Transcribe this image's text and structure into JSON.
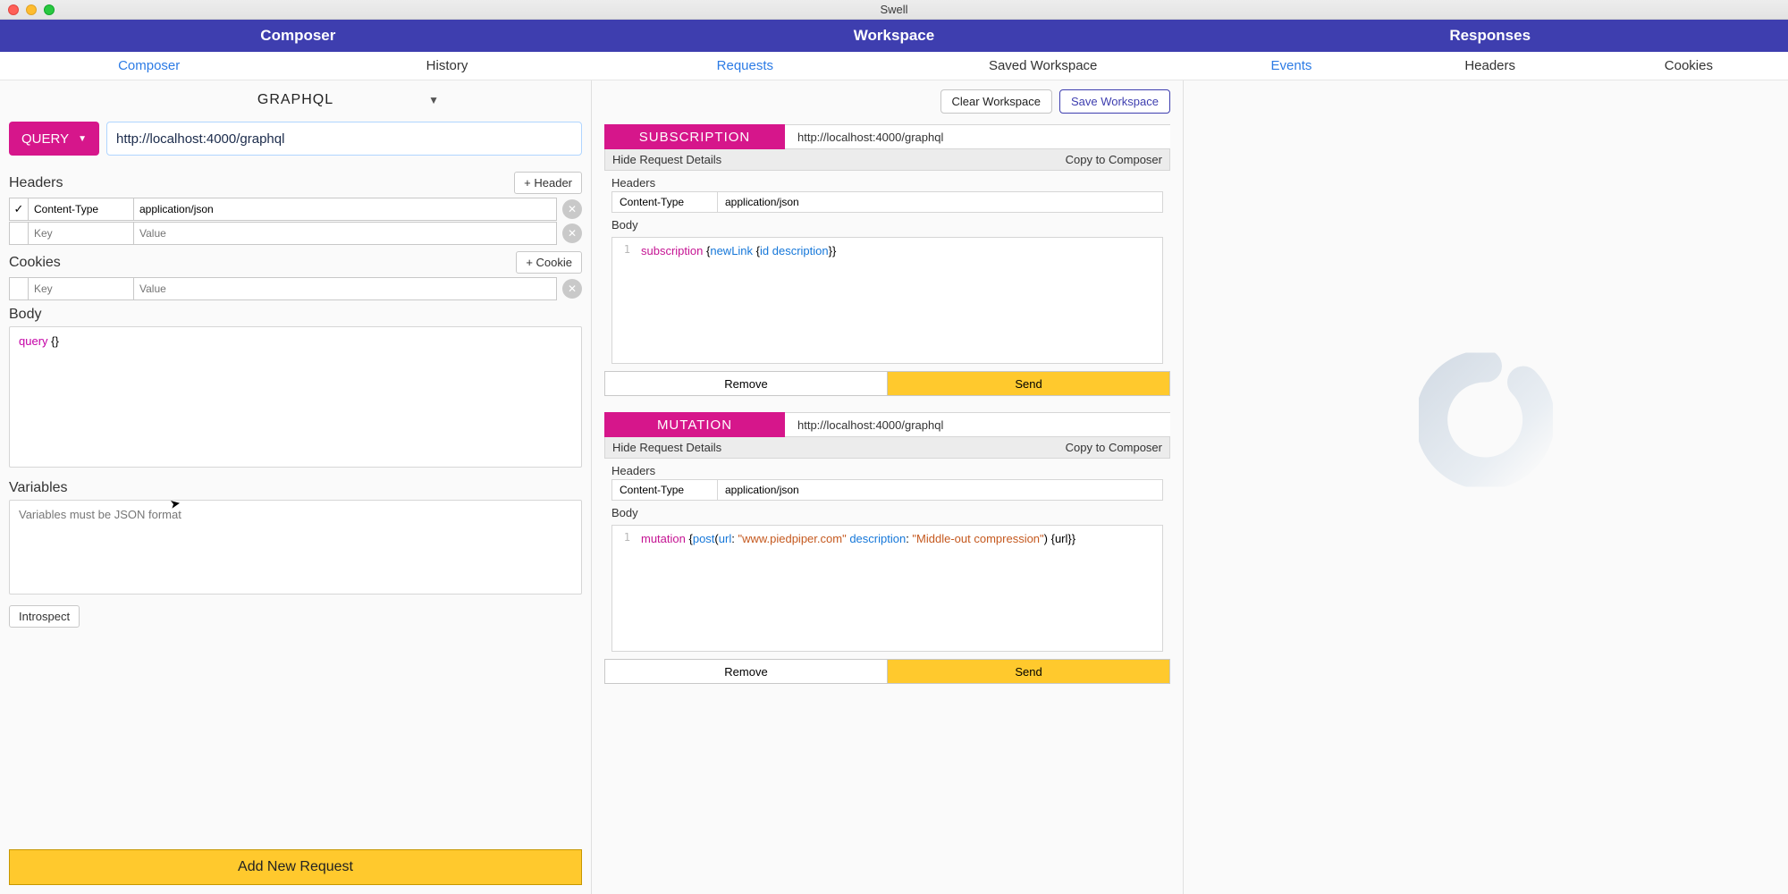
{
  "window": {
    "title": "Swell"
  },
  "topbar": {
    "composer": "Composer",
    "workspace": "Workspace",
    "responses": "Responses"
  },
  "subnav": {
    "composer": {
      "tab1": "Composer",
      "tab2": "History"
    },
    "workspace": {
      "tab1": "Requests",
      "tab2": "Saved Workspace"
    },
    "responses": {
      "tab1": "Events",
      "tab2": "Headers",
      "tab3": "Cookies"
    }
  },
  "composer": {
    "protocol": "GRAPHQL",
    "method": "QUERY",
    "url": "http://localhost:4000/graphql",
    "headers_label": "Headers",
    "add_header": "+ Header",
    "cookies_label": "Cookies",
    "add_cookie": "+ Cookie",
    "header_rows": [
      {
        "checked": true,
        "key": "Content-Type",
        "val": "application/json"
      }
    ],
    "kv_placeholder_key": "Key",
    "kv_placeholder_val": "Value",
    "body_label": "Body",
    "body_code_kw": "query",
    "body_code_rest": " {}",
    "variables_label": "Variables",
    "variables_placeholder": "Variables must be JSON format",
    "introspect": "Introspect",
    "add_new": "Add New Request"
  },
  "workspace": {
    "clear": "Clear Workspace",
    "save": "Save Workspace",
    "hide": "Hide Request Details",
    "copy": "Copy to Composer",
    "remove": "Remove",
    "send": "Send",
    "headers_label": "Headers",
    "body_label": "Body",
    "cards": [
      {
        "type": "SUBSCRIPTION",
        "url": "http://localhost:4000/graphql",
        "header_key": "Content-Type",
        "header_val": "application/json",
        "code": {
          "kw": "subscription",
          "open": " {",
          "fn": "newLink",
          "open2": " {",
          "args": "id description",
          "close": "}}"
        }
      },
      {
        "type": "MUTATION",
        "url": "http://localhost:4000/graphql",
        "header_key": "Content-Type",
        "header_val": "application/json",
        "code": {
          "kw": "mutation",
          "open": " {",
          "fn": "post",
          "paren": "(",
          "arg1k": "url",
          "colon1": ": ",
          "arg1v": "\"www.piedpiper.com\"",
          "sp": " ",
          "arg2k": "description",
          "colon2": ": ",
          "arg2v": "\"Middle-out compression\"",
          "cparen": ")",
          "sel": " {url}}",
          "line2": ""
        }
      }
    ]
  }
}
